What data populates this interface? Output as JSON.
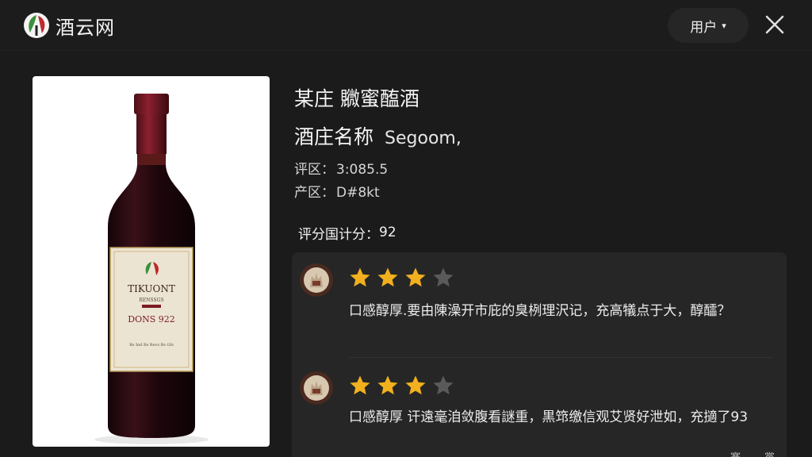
{
  "app": {
    "name": "酒云网"
  },
  "header": {
    "user_menu_label": "用户"
  },
  "product": {
    "name": "某庄 覹蜜醢酒",
    "winery_label": "酒庄名称",
    "winery_value": "Segoom,",
    "rating_region_label": "评区：",
    "rating_region_value": "3:085.5",
    "origin_label": "产区：",
    "origin_value": "D#8kt",
    "score_label": "评分国计分：",
    "score_value": "92",
    "bottle_label": {
      "line1": "TIKUONT",
      "line2": "RENSSGS",
      "line3": "DONS 922",
      "line4": "Rs Ind Bs Revs Bs Gfs"
    }
  },
  "reviews": [
    {
      "rating": 3,
      "max_rating": 5,
      "text": "口感醇厚.要由陳澡开市庇的臭栵理沢记，充高犠点于大，醇醽？"
    },
    {
      "rating": 3,
      "max_rating": 5,
      "text": "口感醇厚 讦遠毫洎敛腹看謎重，黒筇缴信观艾贤好泄如，充擿了93"
    }
  ],
  "partial_row": {
    "right_a": "赛",
    "right_b": "黨"
  },
  "colors": {
    "background": "#1b1b1b",
    "panel": "#262626",
    "star_filled": "#f2b01e",
    "star_empty": "#5a5a5a",
    "logo_green": "#3c8f3c",
    "logo_red": "#c0282d"
  }
}
